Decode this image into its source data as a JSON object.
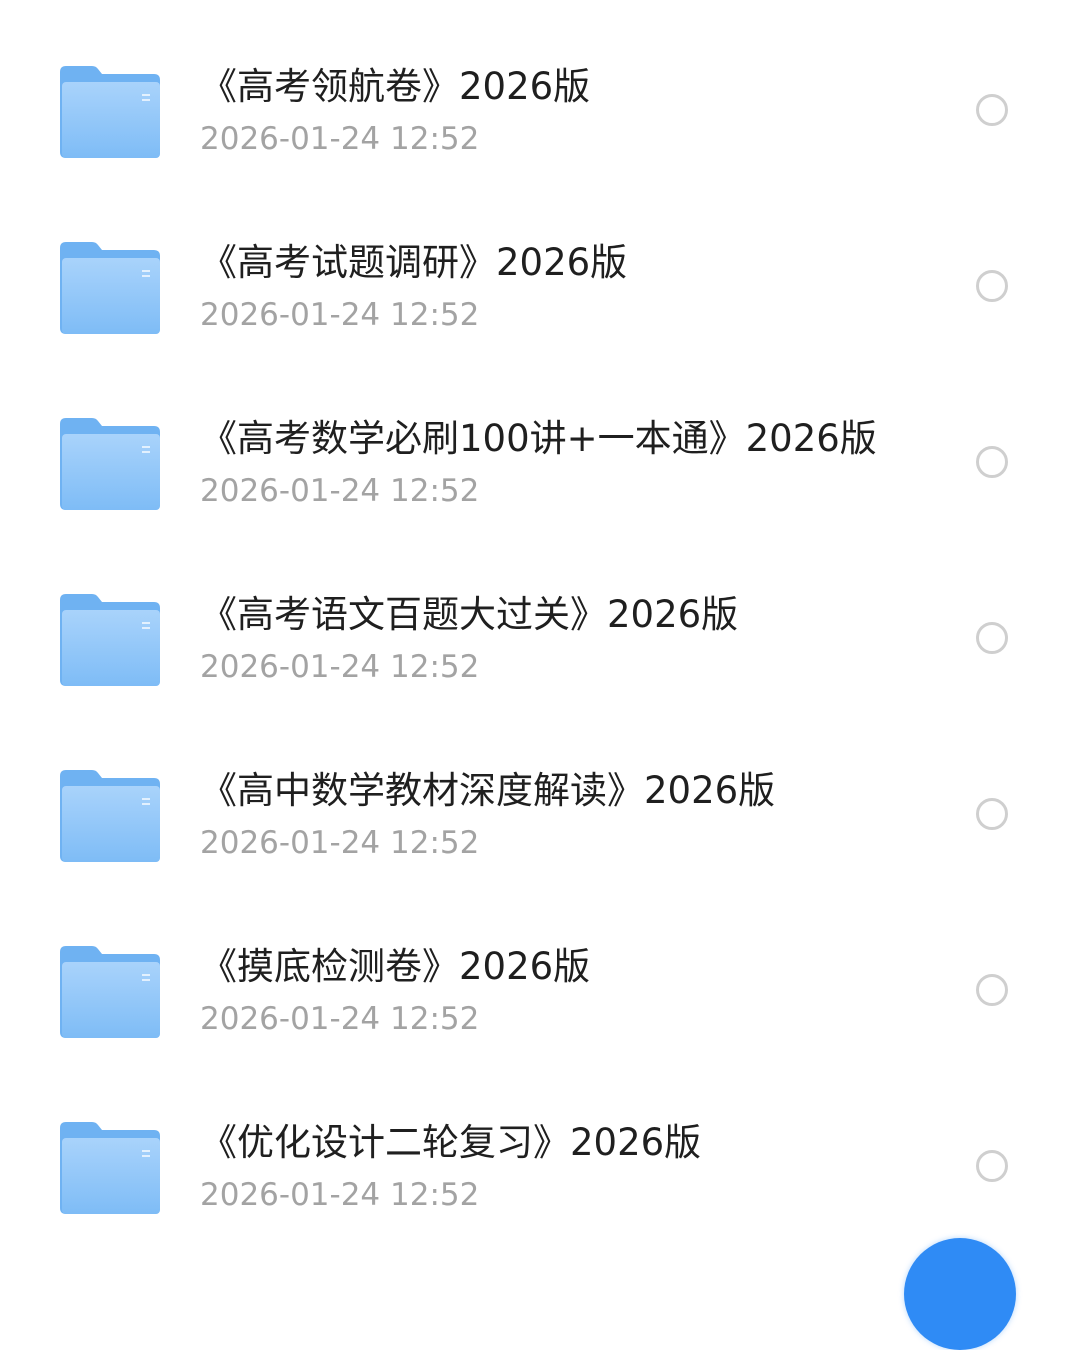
{
  "accent_color": "#2f8bf5",
  "folder_colors": {
    "back": "#6fb2f2",
    "front_top": "#a9d3fb",
    "front_bottom": "#7ebcf6"
  },
  "files": [
    {
      "name": "《高考领航卷》2026版",
      "time": "2026-01-24 12:52",
      "icon": "folder-icon",
      "selected": false
    },
    {
      "name": "《高考试题调研》2026版",
      "time": "2026-01-24 12:52",
      "icon": "folder-icon",
      "selected": false
    },
    {
      "name": "《高考数学必刷100讲+一本通》2026版",
      "time": "2026-01-24 12:52",
      "icon": "folder-icon",
      "selected": false
    },
    {
      "name": "《高考语文百题大过关》2026版",
      "time": "2026-01-24 12:52",
      "icon": "folder-icon",
      "selected": false
    },
    {
      "name": "《高中数学教材深度解读》2026版",
      "time": "2026-01-24 12:52",
      "icon": "folder-icon",
      "selected": false
    },
    {
      "name": "《摸底检测卷》2026版",
      "time": "2026-01-24 12:52",
      "icon": "folder-icon",
      "selected": false
    },
    {
      "name": "《优化设计二轮复习》2026版",
      "time": "2026-01-24 12:52",
      "icon": "folder-icon",
      "selected": false
    }
  ]
}
